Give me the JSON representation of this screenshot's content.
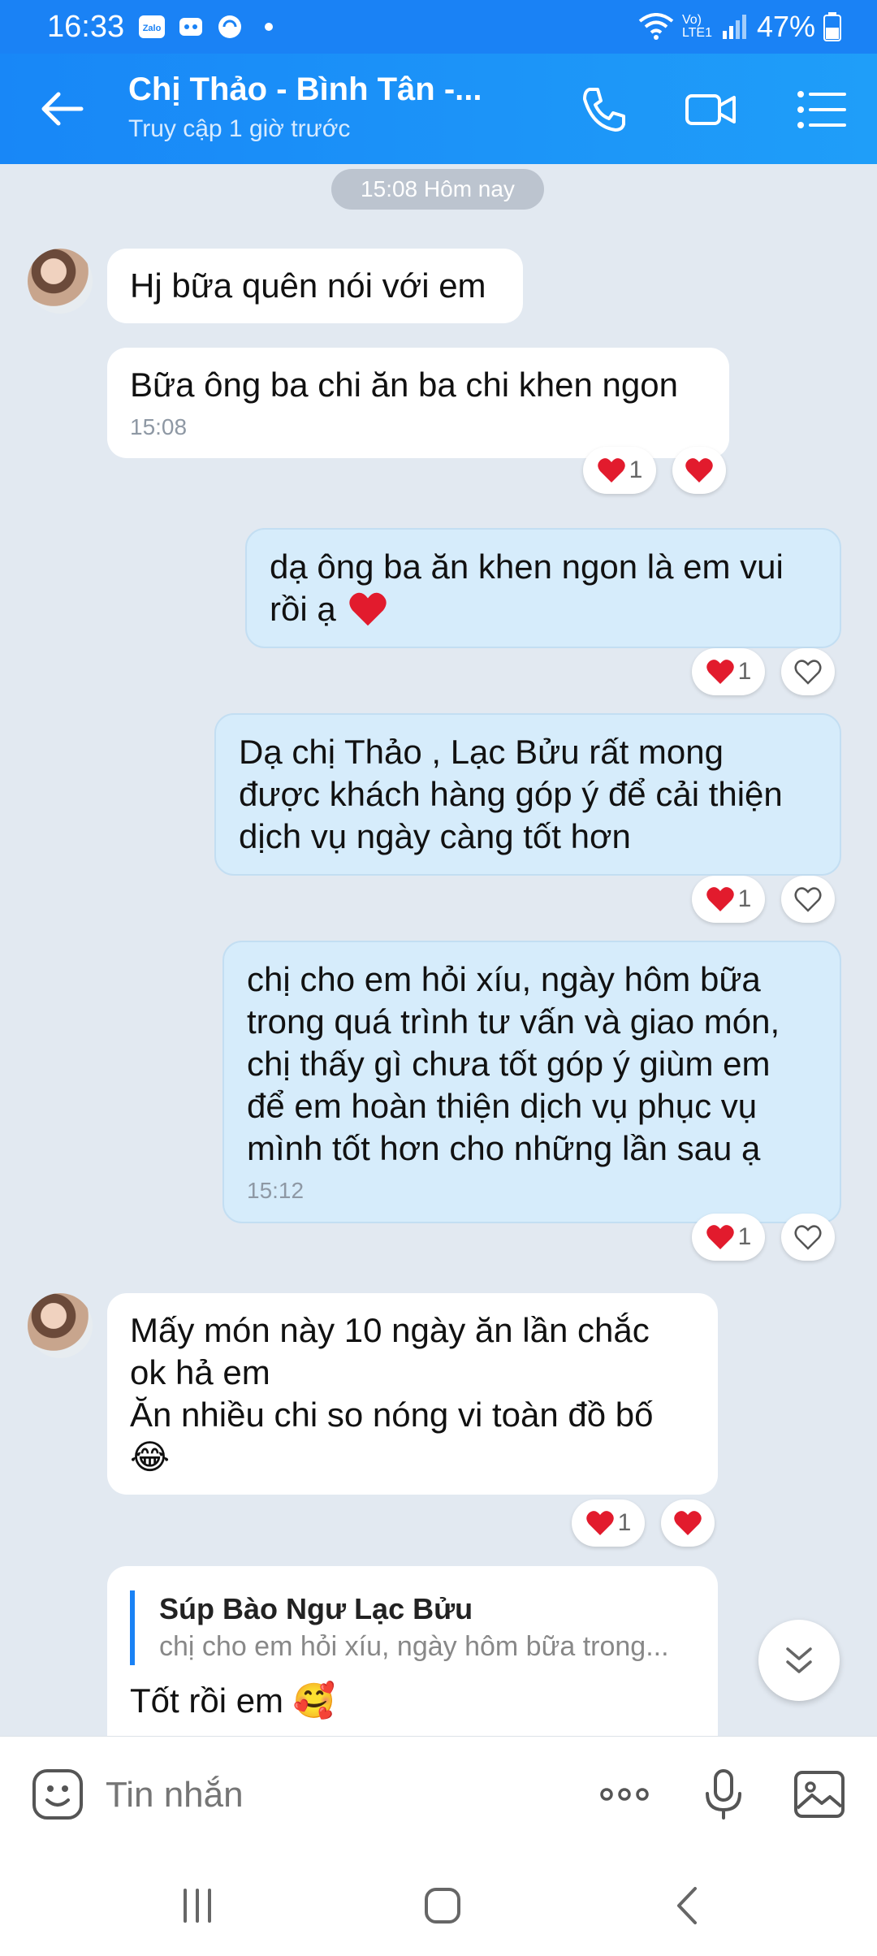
{
  "status": {
    "time": "16:33",
    "network": "Vo) LTE1",
    "battery": "47%"
  },
  "header": {
    "contact_name": "Chị Thảo  - Bình Tân -...",
    "last_seen": "Truy cập 1 giờ trước"
  },
  "chat": {
    "time_separator": "15:08 Hôm nay",
    "messages": [
      {
        "dir": "in",
        "lines": [
          "Hj bữa quên nói với em"
        ]
      },
      {
        "dir": "in",
        "lines": [
          "Bữa ông ba chi ăn ba chi khen ngon"
        ],
        "time": "15:08",
        "reaction_count": "1"
      },
      {
        "dir": "out",
        "lines": [
          "dạ ông ba ăn khen ngon là em vui",
          "rồi ạ"
        ],
        "reaction_count": "1"
      },
      {
        "dir": "out",
        "lines": [
          "Dạ chị Thảo  , Lạc Bửu rất mong",
          "được khách hàng góp ý để cải thiện",
          "dịch vụ ngày càng tốt hơn"
        ],
        "reaction_count": "1"
      },
      {
        "dir": "out",
        "lines": [
          "chị cho em hỏi xíu, ngày hôm bữa",
          "trong quá trình tư vấn và giao món,",
          "chị thấy gì chưa tốt góp ý giùm em",
          "để em hoàn thiện dịch vụ phục vụ",
          "mình tốt hơn cho những lần sau ạ"
        ],
        "time": "15:12",
        "reaction_count": "1"
      },
      {
        "dir": "in",
        "lines": [
          "Mấy món này 10 ngày ăn lần chắc",
          "ok hả em",
          "Ăn nhiều chi so nóng vi toàn đồ bố",
          "😂"
        ],
        "reaction_count": "1"
      },
      {
        "dir": "in",
        "quote_title": "Súp Bào Ngư Lạc Bửu",
        "quote_body": "chị cho em hỏi xíu, ngày hôm bữa trong...",
        "lines": [
          "Tốt rồi em 🥰"
        ]
      }
    ]
  },
  "input": {
    "placeholder": "Tin nhắn"
  },
  "colors": {
    "brand": "#1a82f5",
    "outgoing_bubble": "#d6ecfb",
    "background": "#e2e9f1",
    "heart": "#e21b2d"
  }
}
